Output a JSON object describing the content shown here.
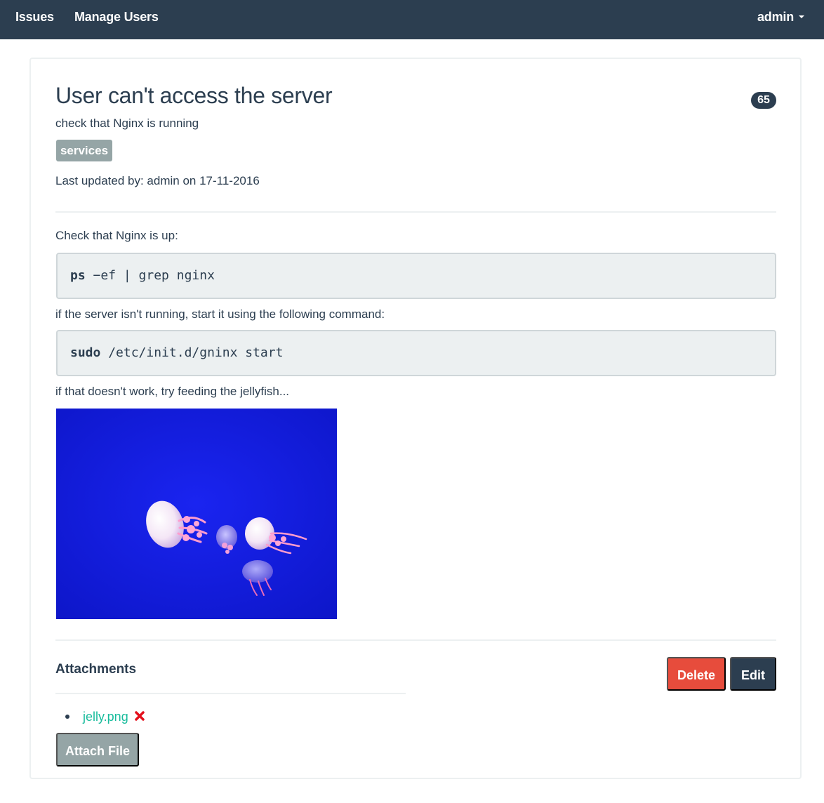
{
  "nav": {
    "issues": "Issues",
    "manage_users": "Manage Users",
    "user": "admin"
  },
  "issue": {
    "title": "User can't access the server",
    "id_badge": "65",
    "description": "check that Nginx is running",
    "tag": "services",
    "last_updated": "Last updated by: admin on 17-11-2016"
  },
  "body": {
    "p1": "Check that Nginx is up:",
    "code1_cmd": "ps",
    "code1_args": " −ef | grep nginx",
    "p2": "if the server isn't running, start it using the following command:",
    "code2_cmd": "sudo",
    "code2_args": " /etc/init.d/gninx start",
    "p3": "if that doesn't work, try feeding the jellyfish..."
  },
  "attachments": {
    "heading": "Attachments",
    "files": [
      {
        "name": "jelly.png"
      }
    ],
    "attach_label": "Attach File"
  },
  "actions": {
    "delete": "Delete",
    "edit": "Edit"
  },
  "colors": {
    "navbar": "#2c3e50",
    "danger": "#e74c3c",
    "link": "#18bc9c",
    "tag": "#95a5a6",
    "code_bg": "#ecf0f1"
  }
}
